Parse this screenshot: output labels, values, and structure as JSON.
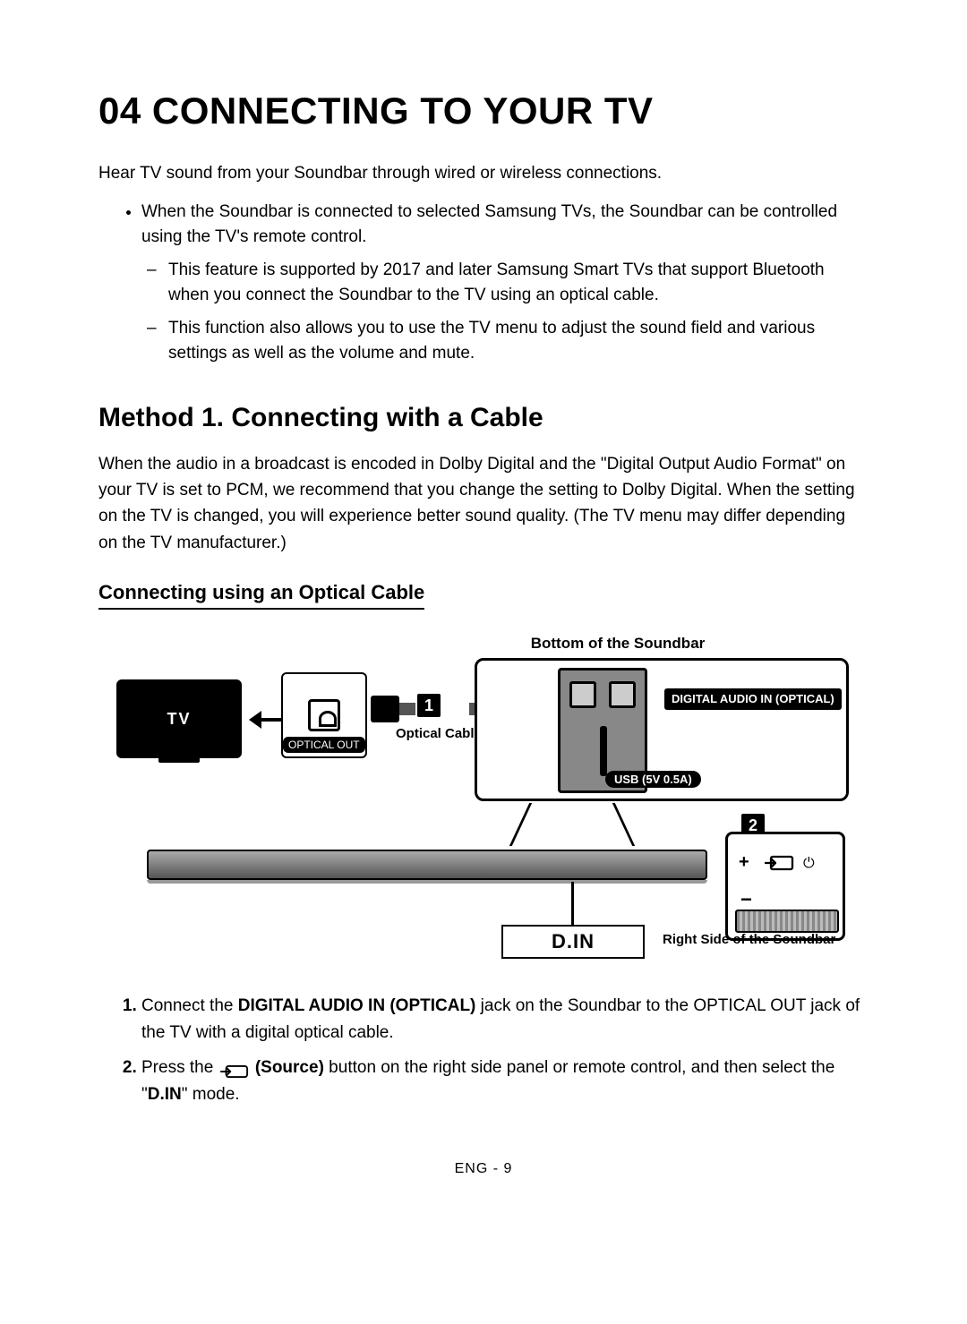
{
  "header": {
    "title": "04  CONNECTING TO YOUR TV"
  },
  "intro": "Hear TV sound from your Soundbar through wired or wireless connections.",
  "bullets": {
    "main": "When the Soundbar is connected to selected Samsung TVs, the Soundbar can be controlled using the TV's remote control.",
    "sub1": "This feature is supported by 2017 and later Samsung Smart TVs that support Bluetooth when you connect the Soundbar to the TV using an optical cable.",
    "sub2": "This function also allows you to use the TV menu to adjust the sound field and various settings as well as the volume and mute."
  },
  "method": {
    "heading": "Method 1. Connecting with a Cable",
    "body": "When the audio in a broadcast is encoded in Dolby Digital and the \"Digital Output Audio Format\" on your TV is set to PCM, we recommend that you change the setting to Dolby Digital. When the setting on the TV is changed, you will experience better sound quality. (The TV menu may differ depending on the TV manufacturer.)",
    "subheading": "Connecting using an Optical Cable"
  },
  "diagram": {
    "top_label": "Bottom of the Soundbar",
    "tv_label": "TV",
    "optical_out": "OPTICAL OUT",
    "optical_cable": "Optical Cable",
    "digital_audio_in": "DIGITAL AUDIO IN (OPTICAL)",
    "usb_label": "USB (5V 0.5A)",
    "din": "D.IN",
    "right_side": "Right Side of the Soundbar",
    "badge1": "1",
    "badge2": "2",
    "plus": "+",
    "minus": "−",
    "power": "⏻"
  },
  "steps": {
    "s1_a": "Connect the ",
    "s1_bold": "DIGITAL AUDIO IN (OPTICAL)",
    "s1_b": " jack on the Soundbar to the OPTICAL OUT jack of the TV with a digital optical cable.",
    "s2_a": "Press the ",
    "s2_source": "(Source)",
    "s2_b": " button on the right side panel or remote control, and then select the \"",
    "s2_din": "D.IN",
    "s2_c": "\" mode."
  },
  "footer": "ENG - 9"
}
